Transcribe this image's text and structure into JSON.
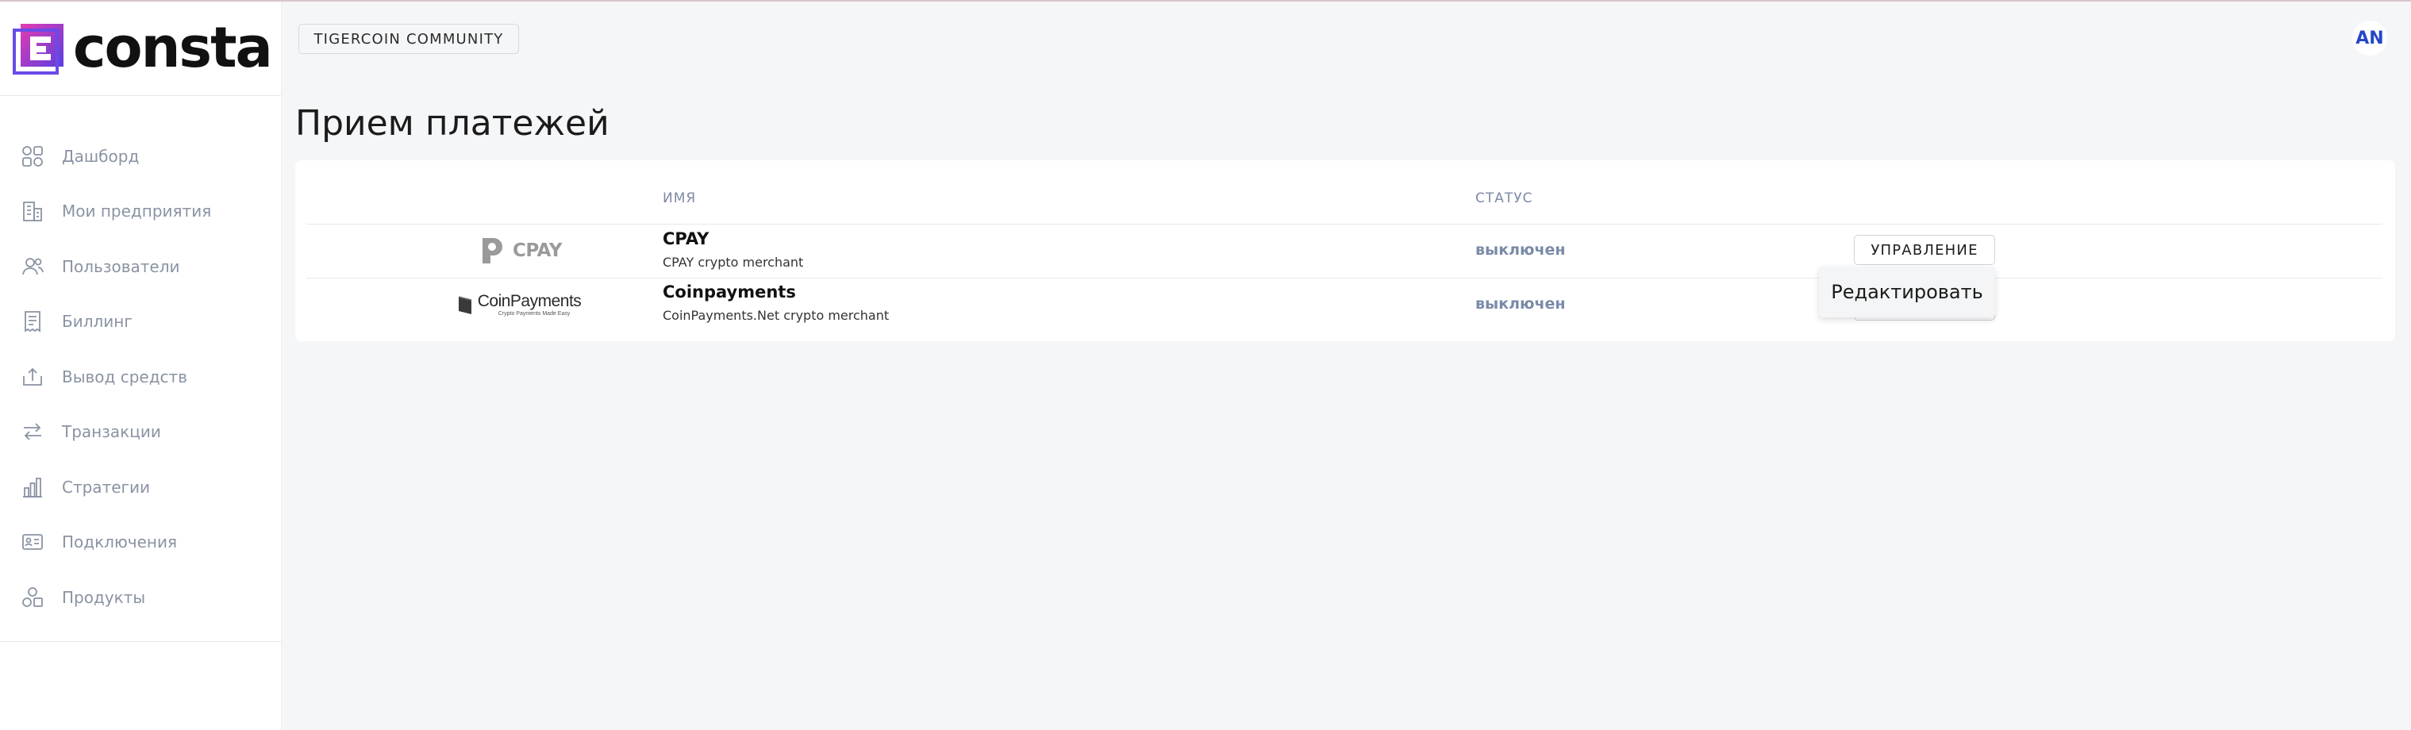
{
  "brand": {
    "name": "consta"
  },
  "header": {
    "workspace_label": "TIGERCOIN COMMUNITY",
    "avatar_initials": "AN"
  },
  "sidebar": {
    "items": [
      {
        "label": "Дашборд",
        "icon": "dashboard-icon"
      },
      {
        "label": "Мои предприятия",
        "icon": "buildings-icon"
      },
      {
        "label": "Пользователи",
        "icon": "users-icon"
      },
      {
        "label": "Биллинг",
        "icon": "receipt-icon"
      },
      {
        "label": "Вывод средств",
        "icon": "withdraw-icon"
      },
      {
        "label": "Транзакции",
        "icon": "transfer-icon"
      },
      {
        "label": "Стратегии",
        "icon": "bar-chart-icon"
      },
      {
        "label": "Подключения",
        "icon": "id-card-icon"
      },
      {
        "label": "Продукты",
        "icon": "products-icon"
      }
    ]
  },
  "main": {
    "title": "Прием платежей",
    "table": {
      "columns": {
        "name": "ИМЯ",
        "status": "СТАТУС"
      },
      "rows": [
        {
          "logo_text": "CPAY",
          "name": "CPAY",
          "description": "CPAY crypto merchant",
          "status": "выключен"
        },
        {
          "logo_text": "CoinPayments",
          "logo_sub": "Crypto Payments Made Easy",
          "name": "Coinpayments",
          "description": "CoinPayments.Net crypto merchant",
          "status": "выключен"
        }
      ]
    },
    "manage_label": "УПРАВЛЕНИЕ",
    "menu": {
      "edit_label": "Редактировать"
    }
  },
  "colors": {
    "accent": "#2646c8",
    "logo_gradient_start": "#e53bb0",
    "logo_gradient_end": "#5a3fe0",
    "status_text": "#7a8aa8"
  }
}
